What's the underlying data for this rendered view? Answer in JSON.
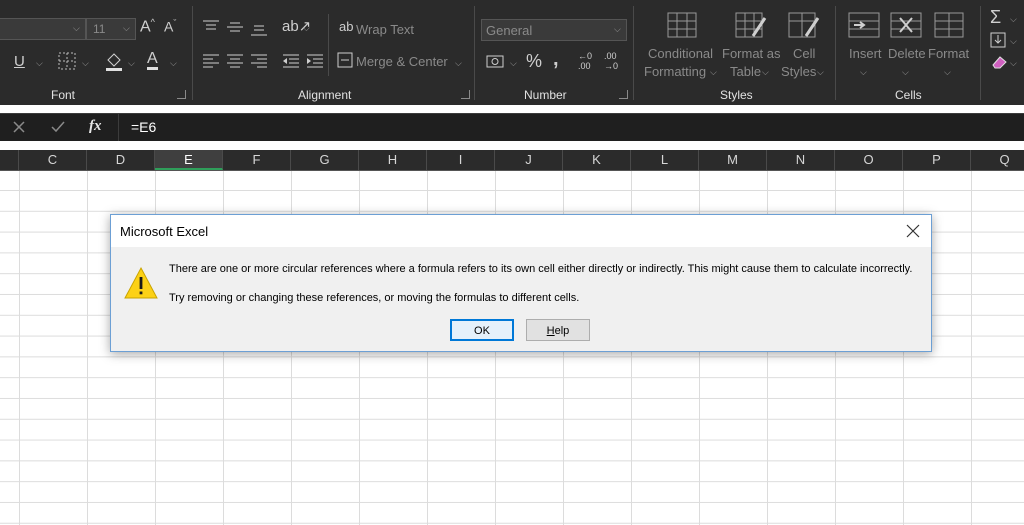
{
  "ribbon": {
    "font": {
      "size_value": "11",
      "group_label": "Font"
    },
    "alignment": {
      "wrap_text": "Wrap Text",
      "merge_center": "Merge & Center",
      "group_label": "Alignment"
    },
    "number": {
      "format_value": "General",
      "percent_symbol": "%",
      "group_label": "Number"
    },
    "styles": {
      "conditional_formatting_line1": "Conditional",
      "conditional_formatting_line2": "Formatting",
      "format_as_table_line1": "Format as",
      "format_as_table_line2": "Table",
      "cell_styles_line1": "Cell",
      "cell_styles_line2": "Styles",
      "group_label": "Styles"
    },
    "cells": {
      "insert": "Insert",
      "delete": "Delete",
      "format": "Format",
      "group_label": "Cells"
    }
  },
  "formula_bar": {
    "fx_label": "fx",
    "value": "=E6"
  },
  "columns": [
    "C",
    "D",
    "E",
    "F",
    "G",
    "H",
    "I",
    "J",
    "K",
    "L",
    "M",
    "N",
    "O",
    "P",
    "Q"
  ],
  "selected_column": "E",
  "dialog": {
    "title": "Microsoft Excel",
    "message_line1": "There are one or more circular references where a formula refers to its own cell either directly or indirectly. This might cause them to calculate incorrectly.",
    "message_line2": "Try removing or changing these references, or moving the formulas to different cells.",
    "ok_label": "OK",
    "help_label": "Help",
    "icon": "warning-icon",
    "accent_color": "#0078d7"
  }
}
